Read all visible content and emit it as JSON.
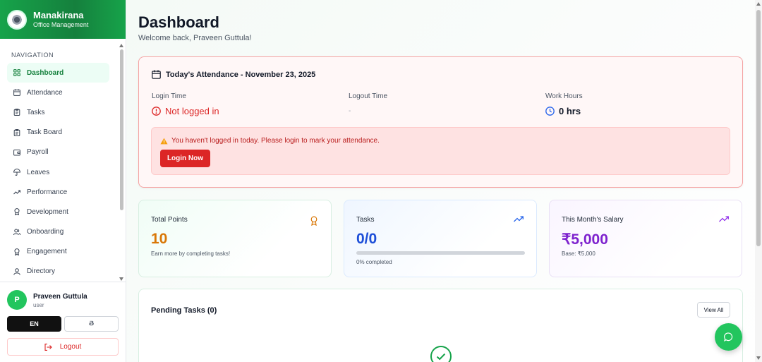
{
  "brand": {
    "title": "Manakirana",
    "subtitle": "Office Management"
  },
  "sidebar": {
    "heading": "NAVIGATION",
    "items": [
      {
        "label": "Dashboard",
        "icon": "grid-icon",
        "active": true
      },
      {
        "label": "Attendance",
        "icon": "calendar-icon"
      },
      {
        "label": "Tasks",
        "icon": "clipboard-icon"
      },
      {
        "label": "Task Board",
        "icon": "clipboard-icon"
      },
      {
        "label": "Payroll",
        "icon": "wallet-icon"
      },
      {
        "label": "Leaves",
        "icon": "umbrella-icon"
      },
      {
        "label": "Performance",
        "icon": "trending-up-icon"
      },
      {
        "label": "Development",
        "icon": "award-icon"
      },
      {
        "label": "Onboarding",
        "icon": "users-icon"
      },
      {
        "label": "Engagement",
        "icon": "award-icon"
      },
      {
        "label": "Directory",
        "icon": "user-icon"
      }
    ]
  },
  "user": {
    "initial": "P",
    "name": "Praveen Guttula",
    "role": "user",
    "lang_primary": "EN",
    "lang_secondary": "తె",
    "logout_label": "Logout"
  },
  "header": {
    "title": "Dashboard",
    "welcome": "Welcome back, Praveen Guttula!"
  },
  "attendance": {
    "title": "Today's Attendance - November 23, 2025",
    "login_label": "Login Time",
    "login_value": "Not logged in",
    "logout_label": "Logout Time",
    "logout_value": "-",
    "hours_label": "Work Hours",
    "hours_value": "0 hrs",
    "alert_text": "You haven't logged in today. Please login to mark your attendance.",
    "login_button": "Login Now"
  },
  "stats": {
    "points": {
      "title": "Total Points",
      "value": "10",
      "note": "Earn more by completing tasks!",
      "color": "#d97706"
    },
    "tasks": {
      "title": "Tasks",
      "value": "0/0",
      "note": "0% completed",
      "progress": 0,
      "color": "#1d4ed8"
    },
    "salary": {
      "title": "This Month's Salary",
      "value": "₹5,000",
      "note": "Base: ₹5,000",
      "color": "#7e22ce"
    }
  },
  "pending": {
    "title": "Pending Tasks (0)",
    "view_all": "View All"
  },
  "colors": {
    "accent": "#16a34a",
    "danger": "#dc2626"
  }
}
